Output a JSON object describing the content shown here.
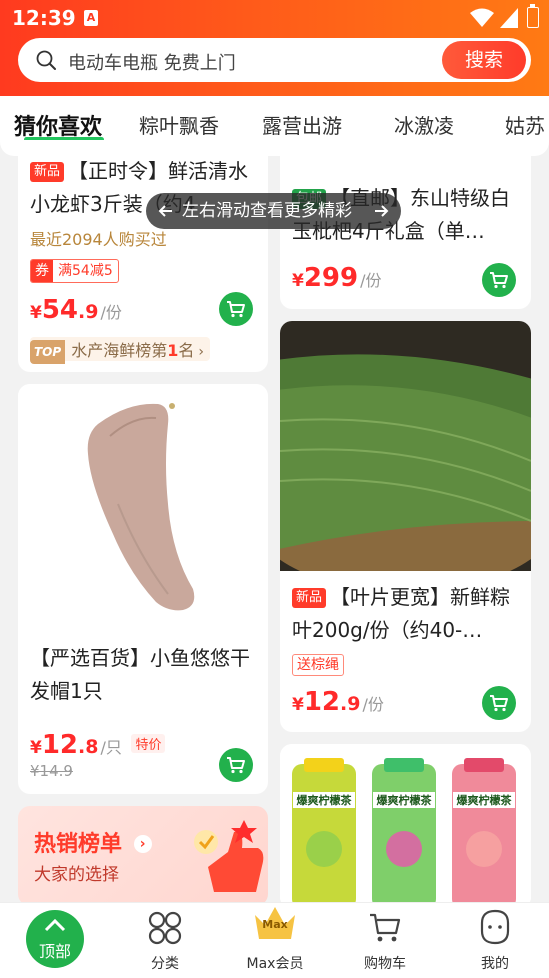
{
  "status_bar": {
    "time": "12:39",
    "app_icon": "A"
  },
  "search": {
    "placeholder": "电动车电瓶 免费上门",
    "button": "搜索"
  },
  "tabs": [
    "猜你喜欢",
    "粽叶飘香",
    "露营出游",
    "冰激凌",
    "姑苏"
  ],
  "active_tab": "猜你喜欢",
  "hint": "左右滑动查看更多精彩",
  "products": [
    {
      "tag": "新品",
      "title": "【正时令】鲜活清水小龙虾3斤装（约4",
      "sales": "最近2094人购买过",
      "coupon_badge": "券",
      "coupon_text": "满54减5",
      "price_currency": "¥",
      "price_int": "54",
      "price_dec": ".9",
      "unit": "/份",
      "rank_badge": "TOP",
      "rank_text_prefix": "水产海鲜榜第",
      "rank_num": "1",
      "rank_text_suffix": "名"
    },
    {
      "tag": "包邮",
      "title": "【直邮】东山特级白玉枇杷4斤礼盒（单…",
      "price_currency": "¥",
      "price_int": "299",
      "price_dec": "",
      "unit": "/份"
    },
    {
      "title": "【严选百货】小鱼悠悠干发帽1只",
      "price_currency": "¥",
      "price_int": "12",
      "price_dec": ".8",
      "unit": "/只",
      "special_tag": "特价",
      "orig_price": "¥14.9"
    },
    {
      "tag": "新品",
      "title": "【叶片更宽】新鲜粽叶200g/份（约40-…",
      "promo_tag": "送棕绳",
      "price_currency": "¥",
      "price_int": "12",
      "price_dec": ".9",
      "unit": "/份"
    },
    {
      "image_labels": [
        "爆爽柠檬茶",
        "爆爽柠檬茶",
        "爆爽柠檬茶"
      ]
    }
  ],
  "hot_list": {
    "title": "热销榜单",
    "subtitle": "大家的选择"
  },
  "bottom_nav": {
    "top_button": "顶部",
    "items": [
      "分类",
      "Max会员",
      "购物车",
      "我的"
    ],
    "max_badge": "Max"
  },
  "colors": {
    "accent": "#ff3b2a",
    "green": "#22b14c",
    "header_start": "#ff3a1f",
    "header_end": "#ff7a14"
  }
}
